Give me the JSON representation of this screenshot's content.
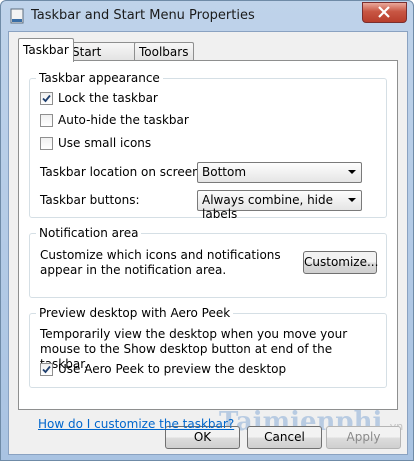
{
  "window": {
    "title": "Taskbar and Start Menu Properties"
  },
  "tabs": [
    {
      "label": "Taskbar"
    },
    {
      "label": "Start Menu"
    },
    {
      "label": "Toolbars"
    }
  ],
  "taskbar_appearance": {
    "label": "Taskbar appearance",
    "lock": {
      "label": "Lock the taskbar",
      "checked": true
    },
    "autohide": {
      "label": "Auto-hide the taskbar",
      "checked": false
    },
    "small_icons": {
      "label": "Use small icons",
      "checked": false
    },
    "location": {
      "label": "Taskbar location on screen:",
      "value": "Bottom"
    },
    "buttons": {
      "label": "Taskbar buttons:",
      "value": "Always combine, hide labels"
    }
  },
  "notification_area": {
    "label": "Notification area",
    "description": "Customize which icons and notifications appear in the notification area.",
    "customize_button": "Customize..."
  },
  "aero_peek": {
    "label": "Preview desktop with Aero Peek",
    "description": "Temporarily view the desktop when you move your mouse to the Show desktop button at end of the taskbar.",
    "checkbox": {
      "label": "Use Aero Peek to preview the desktop",
      "checked": true
    }
  },
  "help_link": "How do I customize the taskbar?",
  "buttons": {
    "ok": "OK",
    "cancel": "Cancel",
    "apply": "Apply"
  },
  "watermark": {
    "text": "Taimienphi",
    "suffix": ".vn"
  }
}
